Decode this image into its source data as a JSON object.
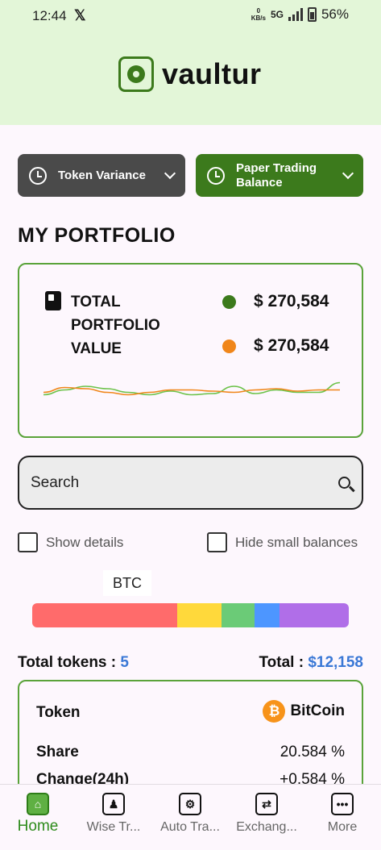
{
  "status_bar": {
    "time": "12:44",
    "net_speed_top": "0",
    "net_speed_unit": "KB/s",
    "network": "5G",
    "battery": "56%"
  },
  "brand": {
    "name": "vaultur"
  },
  "dropdowns": [
    {
      "label": "Token Variance",
      "color": "#4a4a4a"
    },
    {
      "label": "Paper Trading Balance",
      "color": "#3c7a1c"
    }
  ],
  "portfolio": {
    "title": "MY PORTFOLIO",
    "total_label": "TOTAL PORTFOLIO VALUE",
    "values": [
      {
        "value": "$ 270,584",
        "color": "#3c7a1c"
      },
      {
        "value": "$ 270,584",
        "color": "#f0861a"
      }
    ]
  },
  "chart_data": {
    "type": "line",
    "series": [
      {
        "values": [
          0.35,
          0.55,
          0.7,
          0.6,
          0.45,
          0.35,
          0.5,
          0.35,
          0.4,
          0.7,
          0.4,
          0.55,
          0.45,
          0.45,
          0.85
        ],
        "color": "#6cc24a"
      },
      {
        "values": [
          0.45,
          0.65,
          0.6,
          0.45,
          0.35,
          0.45,
          0.55,
          0.55,
          0.5,
          0.45,
          0.55,
          0.6,
          0.5,
          0.55,
          0.55
        ],
        "color": "#f0861a"
      }
    ]
  },
  "search": {
    "placeholder": "Search"
  },
  "options": {
    "show_details": "Show details",
    "hide_small": "Hide small balances"
  },
  "allocation": {
    "selected_label": "BTC",
    "segments": [
      {
        "share": 0.458,
        "color": "#ff6b6b"
      },
      {
        "share": 0.14,
        "color": "#ffd93b"
      },
      {
        "share": 0.105,
        "color": "#6bcb77"
      },
      {
        "share": 0.078,
        "color": "#4d96ff"
      },
      {
        "share": 0.219,
        "color": "#b06ee8"
      }
    ]
  },
  "totals": {
    "tokens_label": "Total tokens : ",
    "tokens_count": "5",
    "total_label": "Total : ",
    "total_value": "$12,158"
  },
  "token": {
    "token_label": "Token",
    "coin_symbol": "₿",
    "coin_name": "BitCoin",
    "share_label": "Share",
    "share_value": "20.584 %",
    "change_label": "Change(24h)",
    "change_value": "+0.584 %"
  },
  "nav": [
    {
      "label": "Home",
      "icon": "home-icon",
      "glyph": "⌂"
    },
    {
      "label": "Wise Tr...",
      "icon": "teacher-icon",
      "glyph": "♟"
    },
    {
      "label": "Auto Tra...",
      "icon": "robot-icon",
      "glyph": "⚙"
    },
    {
      "label": "Exchang...",
      "icon": "exchange-icon",
      "glyph": "⇄"
    },
    {
      "label": "More",
      "icon": "more-icon",
      "glyph": "•••"
    }
  ]
}
